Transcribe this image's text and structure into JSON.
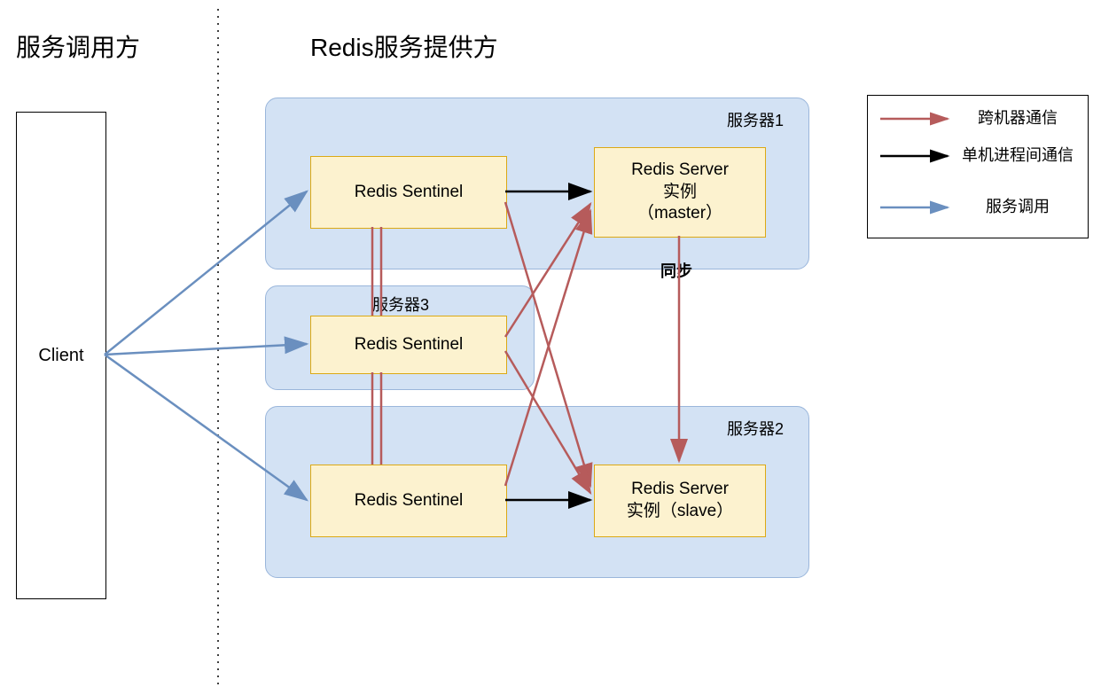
{
  "headings": {
    "left": "服务调用方",
    "right": "Redis服务提供方"
  },
  "client": {
    "label": "Client"
  },
  "servers": {
    "s1": {
      "label": "服务器1"
    },
    "s2": {
      "label": "服务器2"
    },
    "s3": {
      "label": "服务器3"
    }
  },
  "nodes": {
    "sentinel1": "Redis Sentinel",
    "sentinel2": "Redis Sentinel",
    "sentinel3": "Redis Sentinel",
    "master": "Redis Server\n实例\n（master）",
    "slave": "Redis Server\n实例（slave）"
  },
  "sync_label": "同步",
  "legend": {
    "cross_machine": "跨机器通信",
    "local_ipc": "单机进程间通信",
    "service_call": "服务调用"
  },
  "colors": {
    "red": "#b65b5b",
    "black": "#000000",
    "blue": "#6a8fbf",
    "group_fill": "#d3e2f4",
    "group_border": "#9ab6db",
    "node_fill": "#fcf2cf",
    "node_border": "#dba915"
  }
}
